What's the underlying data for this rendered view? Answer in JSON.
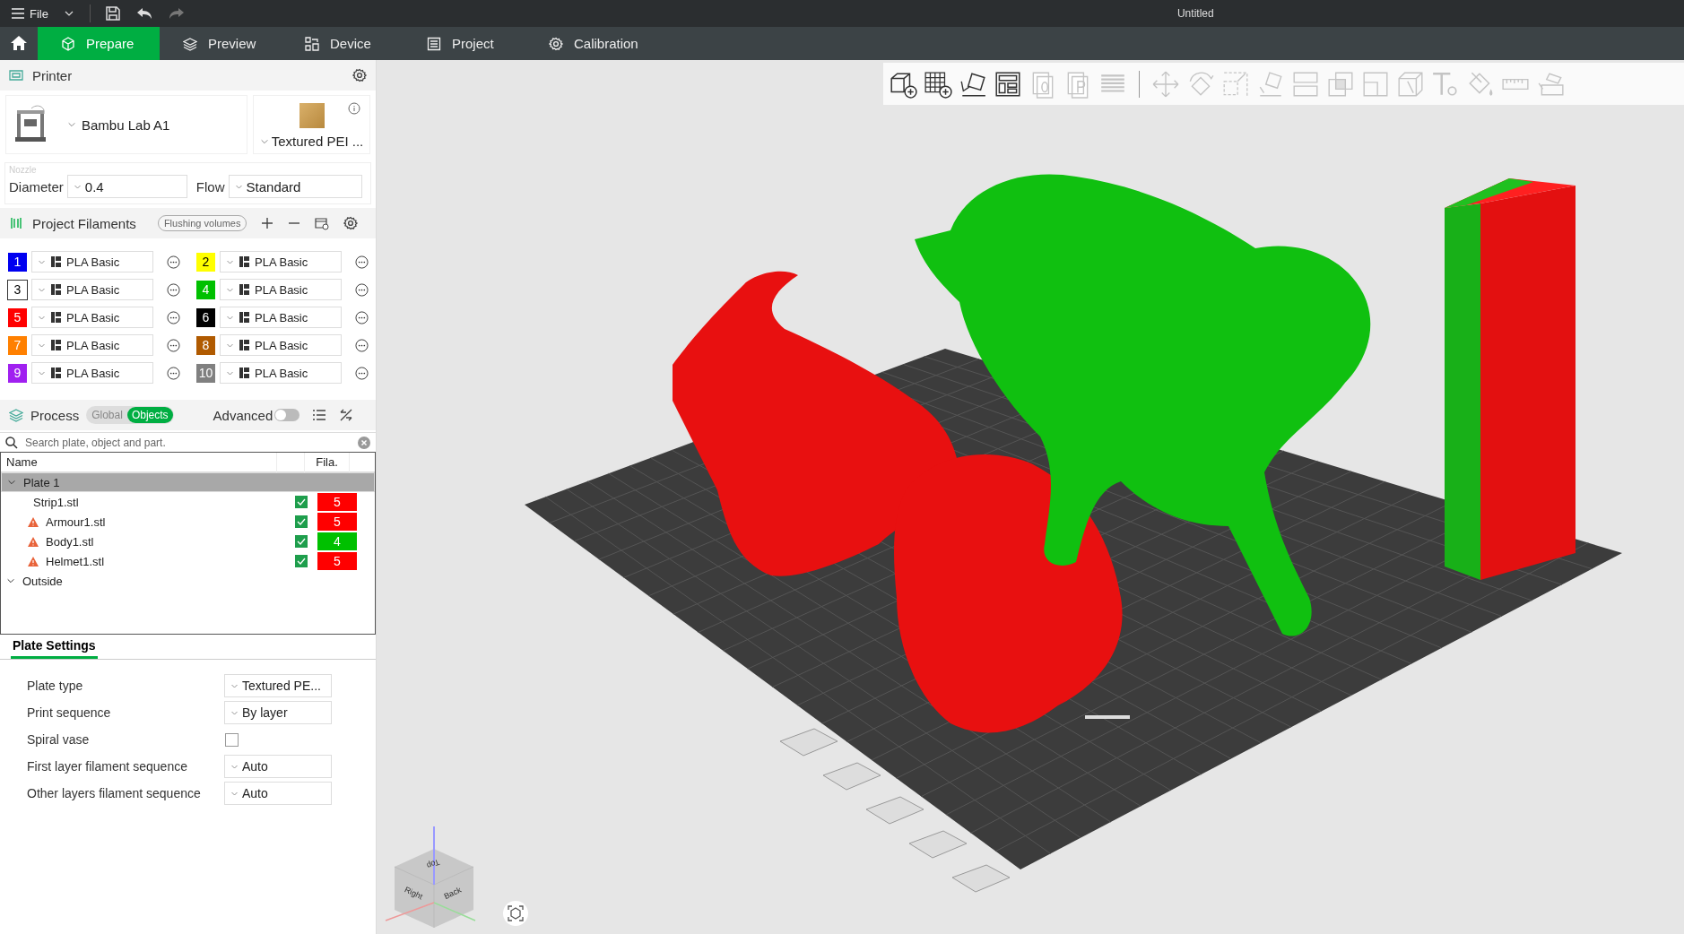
{
  "title_bar": {
    "menu_label": "File",
    "title": "Untitled"
  },
  "tabs": [
    {
      "label": "Prepare",
      "selected": true
    },
    {
      "label": "Preview",
      "selected": false
    },
    {
      "label": "Device",
      "selected": false
    },
    {
      "label": "Project",
      "selected": false
    },
    {
      "label": "Calibration",
      "selected": false
    }
  ],
  "printer": {
    "title": "Printer",
    "printer_name": "Bambu Lab A1",
    "plate_name": "Textured PEI ...",
    "nozzle_label": "Nozzle",
    "diameter_label": "Diameter",
    "diameter": "0.4",
    "flow_label": "Flow",
    "flow": "Standard"
  },
  "filaments": {
    "title": "Project Filaments",
    "flushing_button": "Flushing volumes",
    "items": [
      {
        "number": "1",
        "color": "#0000f0",
        "name": "PLA Basic"
      },
      {
        "number": "2",
        "color": "#ffff00",
        "name": "PLA Basic"
      },
      {
        "number": "3",
        "color": "#ffffff",
        "name": "PLA Basic"
      },
      {
        "number": "4",
        "color": "#00c000",
        "name": "PLA Basic"
      },
      {
        "number": "5",
        "color": "#ff0000",
        "name": "PLA Basic"
      },
      {
        "number": "6",
        "color": "#000000",
        "name": "PLA Basic"
      },
      {
        "number": "7",
        "color": "#ff8000",
        "name": "PLA Basic"
      },
      {
        "number": "8",
        "color": "#b05a00",
        "name": "PLA Basic"
      },
      {
        "number": "9",
        "color": "#a020f0",
        "name": "PLA Basic"
      },
      {
        "number": "10",
        "color": "#808080",
        "name": "PLA Basic"
      }
    ]
  },
  "process": {
    "title": "Process",
    "modes": [
      {
        "label": "Global",
        "selected": false
      },
      {
        "label": "Objects",
        "selected": true
      }
    ],
    "advanced_label": "Advanced",
    "advanced_on": false,
    "search_placeholder": "Search plate, object and part."
  },
  "object_tree": {
    "columns": [
      "Name",
      "Fila."
    ],
    "nodes": [
      {
        "label": "Plate 1",
        "expanded": true,
        "selected": true,
        "children": [
          {
            "label": "Strip1.stl",
            "warning": false,
            "visible": true,
            "filament": "5",
            "color": "#ff0000"
          },
          {
            "label": "Armour1.stl",
            "warning": true,
            "visible": true,
            "filament": "5",
            "color": "#ff0000"
          },
          {
            "label": "Body1.stl",
            "warning": true,
            "visible": true,
            "filament": "4",
            "color": "#00c000"
          },
          {
            "label": "Helmet1.stl",
            "warning": true,
            "visible": true,
            "filament": "5",
            "color": "#ff0000"
          }
        ]
      },
      {
        "label": "Outside",
        "expanded": true,
        "selected": false
      }
    ]
  },
  "plate_settings": {
    "tab": "Plate Settings",
    "rows": [
      {
        "kind": "select",
        "label": "Plate type",
        "value": "Textured PE..."
      },
      {
        "kind": "select",
        "label": "Print sequence",
        "value": "By layer"
      },
      {
        "kind": "checkbox",
        "label": "Spiral vase",
        "checked": false
      },
      {
        "kind": "select",
        "label": "First layer filament sequence",
        "value": "Auto"
      },
      {
        "kind": "select",
        "label": "Other layers filament sequence",
        "value": "Auto"
      }
    ]
  },
  "toolbar": [
    {
      "kind": "add",
      "disabled": false
    },
    {
      "kind": "grid-add",
      "disabled": false
    },
    {
      "kind": "auto-orient",
      "disabled": false
    },
    {
      "kind": "arrange",
      "disabled": false
    },
    {
      "kind": "plate0",
      "disabled": true
    },
    {
      "kind": "plateP",
      "disabled": true
    },
    {
      "kind": "layers",
      "disabled": true
    },
    {
      "kind": "separator"
    },
    {
      "kind": "move",
      "disabled": true
    },
    {
      "kind": "rotate",
      "disabled": true
    },
    {
      "kind": "scale",
      "disabled": true
    },
    {
      "kind": "lay-flat",
      "disabled": true
    },
    {
      "kind": "cut",
      "disabled": true
    },
    {
      "kind": "boolean",
      "disabled": true
    },
    {
      "kind": "support",
      "disabled": true
    },
    {
      "kind": "seam",
      "disabled": true
    },
    {
      "kind": "text",
      "disabled": true
    },
    {
      "kind": "paint",
      "disabled": true
    },
    {
      "kind": "measure",
      "disabled": true
    },
    {
      "kind": "assembly",
      "disabled": true
    }
  ],
  "view_cube": {
    "faces": [
      "Top",
      "Right",
      "Back"
    ]
  }
}
